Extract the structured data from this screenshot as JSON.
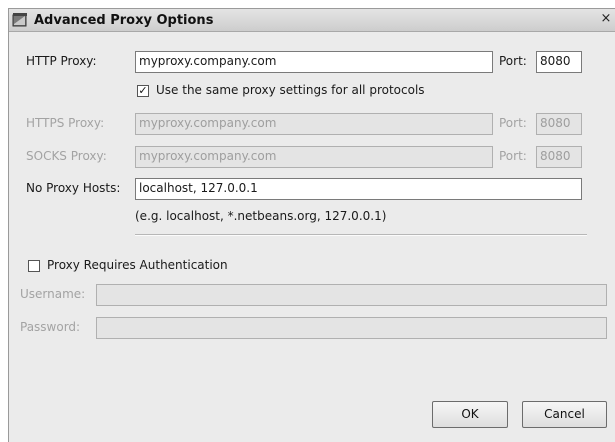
{
  "window": {
    "title": "Advanced Proxy Options",
    "close_glyph": "×"
  },
  "http": {
    "label": "HTTP Proxy:",
    "value": "myproxy.company.com",
    "port_label": "Port:",
    "port": "8080"
  },
  "same_settings": {
    "checked": true,
    "label": "Use the same proxy settings for all protocols"
  },
  "https": {
    "label": "HTTPS Proxy:",
    "value": "myproxy.company.com",
    "port_label": "Port:",
    "port": "8080"
  },
  "socks": {
    "label": "SOCKS Proxy:",
    "value": "myproxy.company.com",
    "port_label": "Port:",
    "port": "8080"
  },
  "no_proxy": {
    "label": "No Proxy Hosts:",
    "value": "localhost, 127.0.0.1",
    "hint": "(e.g. localhost, *.netbeans.org, 127.0.0.1)"
  },
  "auth": {
    "checked": false,
    "label": "Proxy Requires Authentication"
  },
  "username": {
    "label": "Username:",
    "value": ""
  },
  "password": {
    "label": "Password:",
    "value": ""
  },
  "buttons": {
    "ok": "OK",
    "cancel": "Cancel"
  },
  "icons": {
    "app": "netbeans-window-icon",
    "close": "close-icon",
    "check": "checkmark-icon"
  }
}
